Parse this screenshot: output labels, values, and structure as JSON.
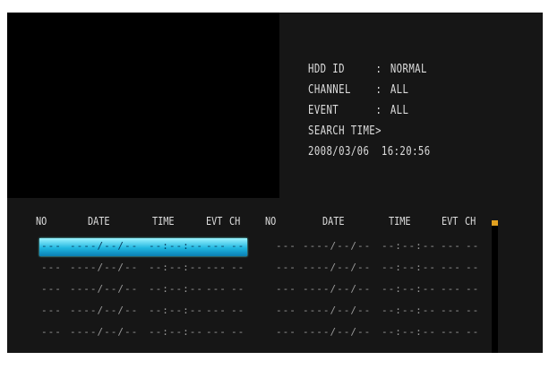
{
  "info": {
    "hdd_id": {
      "label": "HDD ID",
      "value": "NORMAL"
    },
    "channel": {
      "label": "CHANNEL",
      "value": "ALL"
    },
    "event": {
      "label": "EVENT",
      "value": "ALL"
    },
    "search_time_label": "SEARCH TIME>",
    "search_time_value": "2008/03/06  16:20:56",
    "separator": ":"
  },
  "table": {
    "headers": [
      "NO",
      "DATE",
      "TIME",
      "EVT",
      "CH"
    ],
    "rows": [
      {
        "no": "---",
        "date": "----/--/--",
        "time": "--:--:--",
        "evt": "---",
        "ch": "--"
      },
      {
        "no": "---",
        "date": "----/--/--",
        "time": "--:--:--",
        "evt": "---",
        "ch": "--"
      },
      {
        "no": "---",
        "date": "----/--/--",
        "time": "--:--:--",
        "evt": "---",
        "ch": "--"
      },
      {
        "no": "---",
        "date": "----/--/--",
        "time": "--:--:--",
        "evt": "---",
        "ch": "--"
      },
      {
        "no": "---",
        "date": "----/--/--",
        "time": "--:--:--",
        "evt": "---",
        "ch": "--"
      }
    ],
    "rows_right": [
      {
        "no": "---",
        "date": "----/--/--",
        "time": "--:--:--",
        "evt": "---",
        "ch": "--"
      },
      {
        "no": "---",
        "date": "----/--/--",
        "time": "--:--:--",
        "evt": "---",
        "ch": "--"
      },
      {
        "no": "---",
        "date": "----/--/--",
        "time": "--:--:--",
        "evt": "---",
        "ch": "--"
      },
      {
        "no": "---",
        "date": "----/--/--",
        "time": "--:--:--",
        "evt": "---",
        "ch": "--"
      },
      {
        "no": "---",
        "date": "----/--/--",
        "time": "--:--:--",
        "evt": "---",
        "ch": "--"
      }
    ],
    "selected_row": 0
  },
  "colors": {
    "highlight": "#1fb6e0",
    "scroll_thumb": "#e0a020",
    "text": "#dcdcdc"
  }
}
